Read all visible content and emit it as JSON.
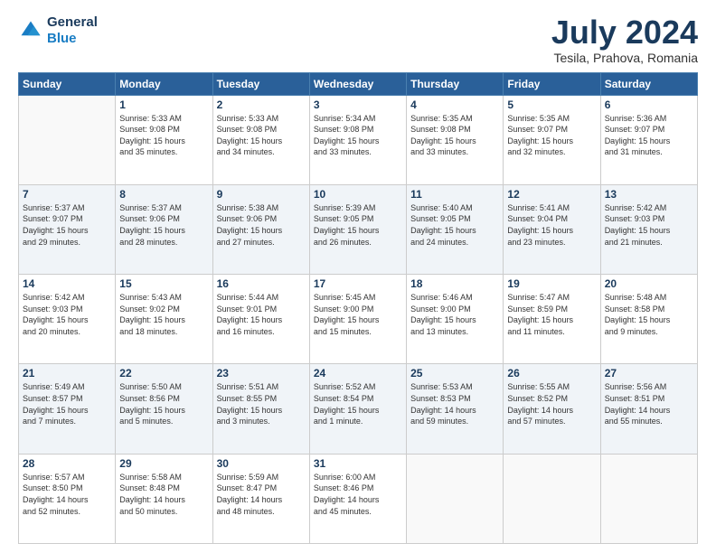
{
  "header": {
    "logo_line1": "General",
    "logo_line2": "Blue",
    "title": "July 2024",
    "subtitle": "Tesila, Prahova, Romania"
  },
  "weekdays": [
    "Sunday",
    "Monday",
    "Tuesday",
    "Wednesday",
    "Thursday",
    "Friday",
    "Saturday"
  ],
  "weeks": [
    [
      {
        "num": "",
        "info": ""
      },
      {
        "num": "1",
        "info": "Sunrise: 5:33 AM\nSunset: 9:08 PM\nDaylight: 15 hours\nand 35 minutes."
      },
      {
        "num": "2",
        "info": "Sunrise: 5:33 AM\nSunset: 9:08 PM\nDaylight: 15 hours\nand 34 minutes."
      },
      {
        "num": "3",
        "info": "Sunrise: 5:34 AM\nSunset: 9:08 PM\nDaylight: 15 hours\nand 33 minutes."
      },
      {
        "num": "4",
        "info": "Sunrise: 5:35 AM\nSunset: 9:08 PM\nDaylight: 15 hours\nand 33 minutes."
      },
      {
        "num": "5",
        "info": "Sunrise: 5:35 AM\nSunset: 9:07 PM\nDaylight: 15 hours\nand 32 minutes."
      },
      {
        "num": "6",
        "info": "Sunrise: 5:36 AM\nSunset: 9:07 PM\nDaylight: 15 hours\nand 31 minutes."
      }
    ],
    [
      {
        "num": "7",
        "info": "Sunrise: 5:37 AM\nSunset: 9:07 PM\nDaylight: 15 hours\nand 29 minutes."
      },
      {
        "num": "8",
        "info": "Sunrise: 5:37 AM\nSunset: 9:06 PM\nDaylight: 15 hours\nand 28 minutes."
      },
      {
        "num": "9",
        "info": "Sunrise: 5:38 AM\nSunset: 9:06 PM\nDaylight: 15 hours\nand 27 minutes."
      },
      {
        "num": "10",
        "info": "Sunrise: 5:39 AM\nSunset: 9:05 PM\nDaylight: 15 hours\nand 26 minutes."
      },
      {
        "num": "11",
        "info": "Sunrise: 5:40 AM\nSunset: 9:05 PM\nDaylight: 15 hours\nand 24 minutes."
      },
      {
        "num": "12",
        "info": "Sunrise: 5:41 AM\nSunset: 9:04 PM\nDaylight: 15 hours\nand 23 minutes."
      },
      {
        "num": "13",
        "info": "Sunrise: 5:42 AM\nSunset: 9:03 PM\nDaylight: 15 hours\nand 21 minutes."
      }
    ],
    [
      {
        "num": "14",
        "info": "Sunrise: 5:42 AM\nSunset: 9:03 PM\nDaylight: 15 hours\nand 20 minutes."
      },
      {
        "num": "15",
        "info": "Sunrise: 5:43 AM\nSunset: 9:02 PM\nDaylight: 15 hours\nand 18 minutes."
      },
      {
        "num": "16",
        "info": "Sunrise: 5:44 AM\nSunset: 9:01 PM\nDaylight: 15 hours\nand 16 minutes."
      },
      {
        "num": "17",
        "info": "Sunrise: 5:45 AM\nSunset: 9:00 PM\nDaylight: 15 hours\nand 15 minutes."
      },
      {
        "num": "18",
        "info": "Sunrise: 5:46 AM\nSunset: 9:00 PM\nDaylight: 15 hours\nand 13 minutes."
      },
      {
        "num": "19",
        "info": "Sunrise: 5:47 AM\nSunset: 8:59 PM\nDaylight: 15 hours\nand 11 minutes."
      },
      {
        "num": "20",
        "info": "Sunrise: 5:48 AM\nSunset: 8:58 PM\nDaylight: 15 hours\nand 9 minutes."
      }
    ],
    [
      {
        "num": "21",
        "info": "Sunrise: 5:49 AM\nSunset: 8:57 PM\nDaylight: 15 hours\nand 7 minutes."
      },
      {
        "num": "22",
        "info": "Sunrise: 5:50 AM\nSunset: 8:56 PM\nDaylight: 15 hours\nand 5 minutes."
      },
      {
        "num": "23",
        "info": "Sunrise: 5:51 AM\nSunset: 8:55 PM\nDaylight: 15 hours\nand 3 minutes."
      },
      {
        "num": "24",
        "info": "Sunrise: 5:52 AM\nSunset: 8:54 PM\nDaylight: 15 hours\nand 1 minute."
      },
      {
        "num": "25",
        "info": "Sunrise: 5:53 AM\nSunset: 8:53 PM\nDaylight: 14 hours\nand 59 minutes."
      },
      {
        "num": "26",
        "info": "Sunrise: 5:55 AM\nSunset: 8:52 PM\nDaylight: 14 hours\nand 57 minutes."
      },
      {
        "num": "27",
        "info": "Sunrise: 5:56 AM\nSunset: 8:51 PM\nDaylight: 14 hours\nand 55 minutes."
      }
    ],
    [
      {
        "num": "28",
        "info": "Sunrise: 5:57 AM\nSunset: 8:50 PM\nDaylight: 14 hours\nand 52 minutes."
      },
      {
        "num": "29",
        "info": "Sunrise: 5:58 AM\nSunset: 8:48 PM\nDaylight: 14 hours\nand 50 minutes."
      },
      {
        "num": "30",
        "info": "Sunrise: 5:59 AM\nSunset: 8:47 PM\nDaylight: 14 hours\nand 48 minutes."
      },
      {
        "num": "31",
        "info": "Sunrise: 6:00 AM\nSunset: 8:46 PM\nDaylight: 14 hours\nand 45 minutes."
      },
      {
        "num": "",
        "info": ""
      },
      {
        "num": "",
        "info": ""
      },
      {
        "num": "",
        "info": ""
      }
    ]
  ]
}
